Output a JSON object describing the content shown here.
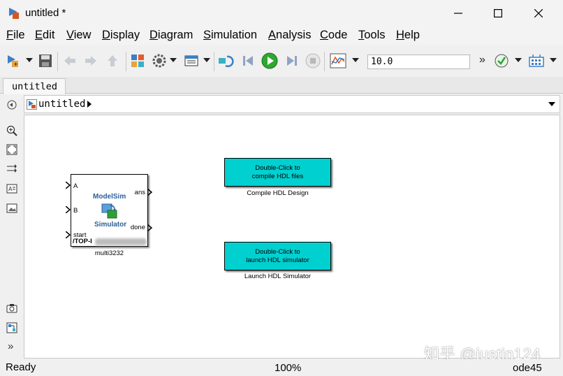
{
  "window": {
    "title": "untitled *"
  },
  "menu": [
    "File",
    "Edit",
    "View",
    "Display",
    "Diagram",
    "Simulation",
    "Analysis",
    "Code",
    "Tools",
    "Help"
  ],
  "toolbar": {
    "stop_time": "10.0"
  },
  "tab": {
    "label": "untitled"
  },
  "breadcrumb": {
    "path": "untitled"
  },
  "blocks": {
    "modelsim": {
      "title_line1": "ModelSim",
      "title_line2": "Simulator",
      "in_ports": [
        "A",
        "B",
        "start"
      ],
      "out_ports": [
        "ans",
        "done"
      ],
      "instance_label": "/TOP-I",
      "name": "multi3232"
    },
    "compile": {
      "text_line1": "Double-Click to",
      "text_line2": "compile HDL files",
      "name": "Compile HDL Design"
    },
    "launch": {
      "text_line1": "Double-Click to",
      "text_line2": "launch HDL simulator",
      "name": "Launch HDL Simulator"
    }
  },
  "watermark": "知乎 @justin124",
  "status": {
    "left": "Ready",
    "zoom": "100%",
    "solver": "ode45"
  },
  "colors": {
    "block_fill": "#00d0d0",
    "modelsim_text": "#2a6099",
    "run_green": "#2fa82f"
  }
}
